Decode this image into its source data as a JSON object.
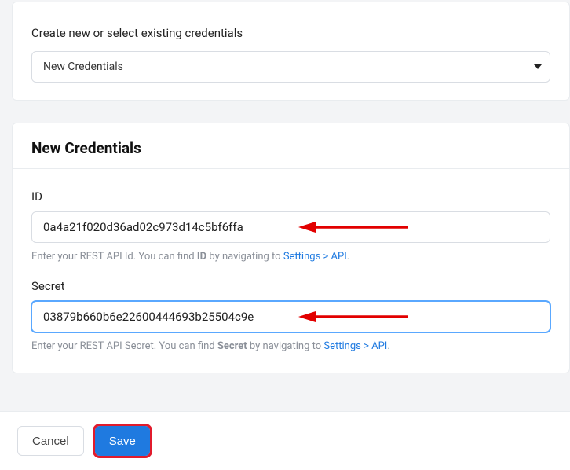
{
  "selectCard": {
    "label": "Create new or select existing credentials",
    "dropdownValue": "New Credentials"
  },
  "credCard": {
    "title": "New Credentials",
    "id": {
      "label": "ID",
      "value": "0a4a21f020d36ad02c973d14c5bf6ffa",
      "hintPrefix": "Enter your REST API Id. You can find ",
      "hintBold": "ID",
      "hintMiddle": " by navigating to ",
      "hintLink": "Settings > API",
      "hintSuffix": "."
    },
    "secret": {
      "label": "Secret",
      "value": "03879b660b6e22600444693b25504c9e",
      "hintPrefix": "Enter your REST API Secret. You can find ",
      "hintBold": "Secret",
      "hintMiddle": " by navigating to ",
      "hintLink": "Settings > API",
      "hintSuffix": "."
    }
  },
  "footer": {
    "cancel": "Cancel",
    "save": "Save"
  }
}
